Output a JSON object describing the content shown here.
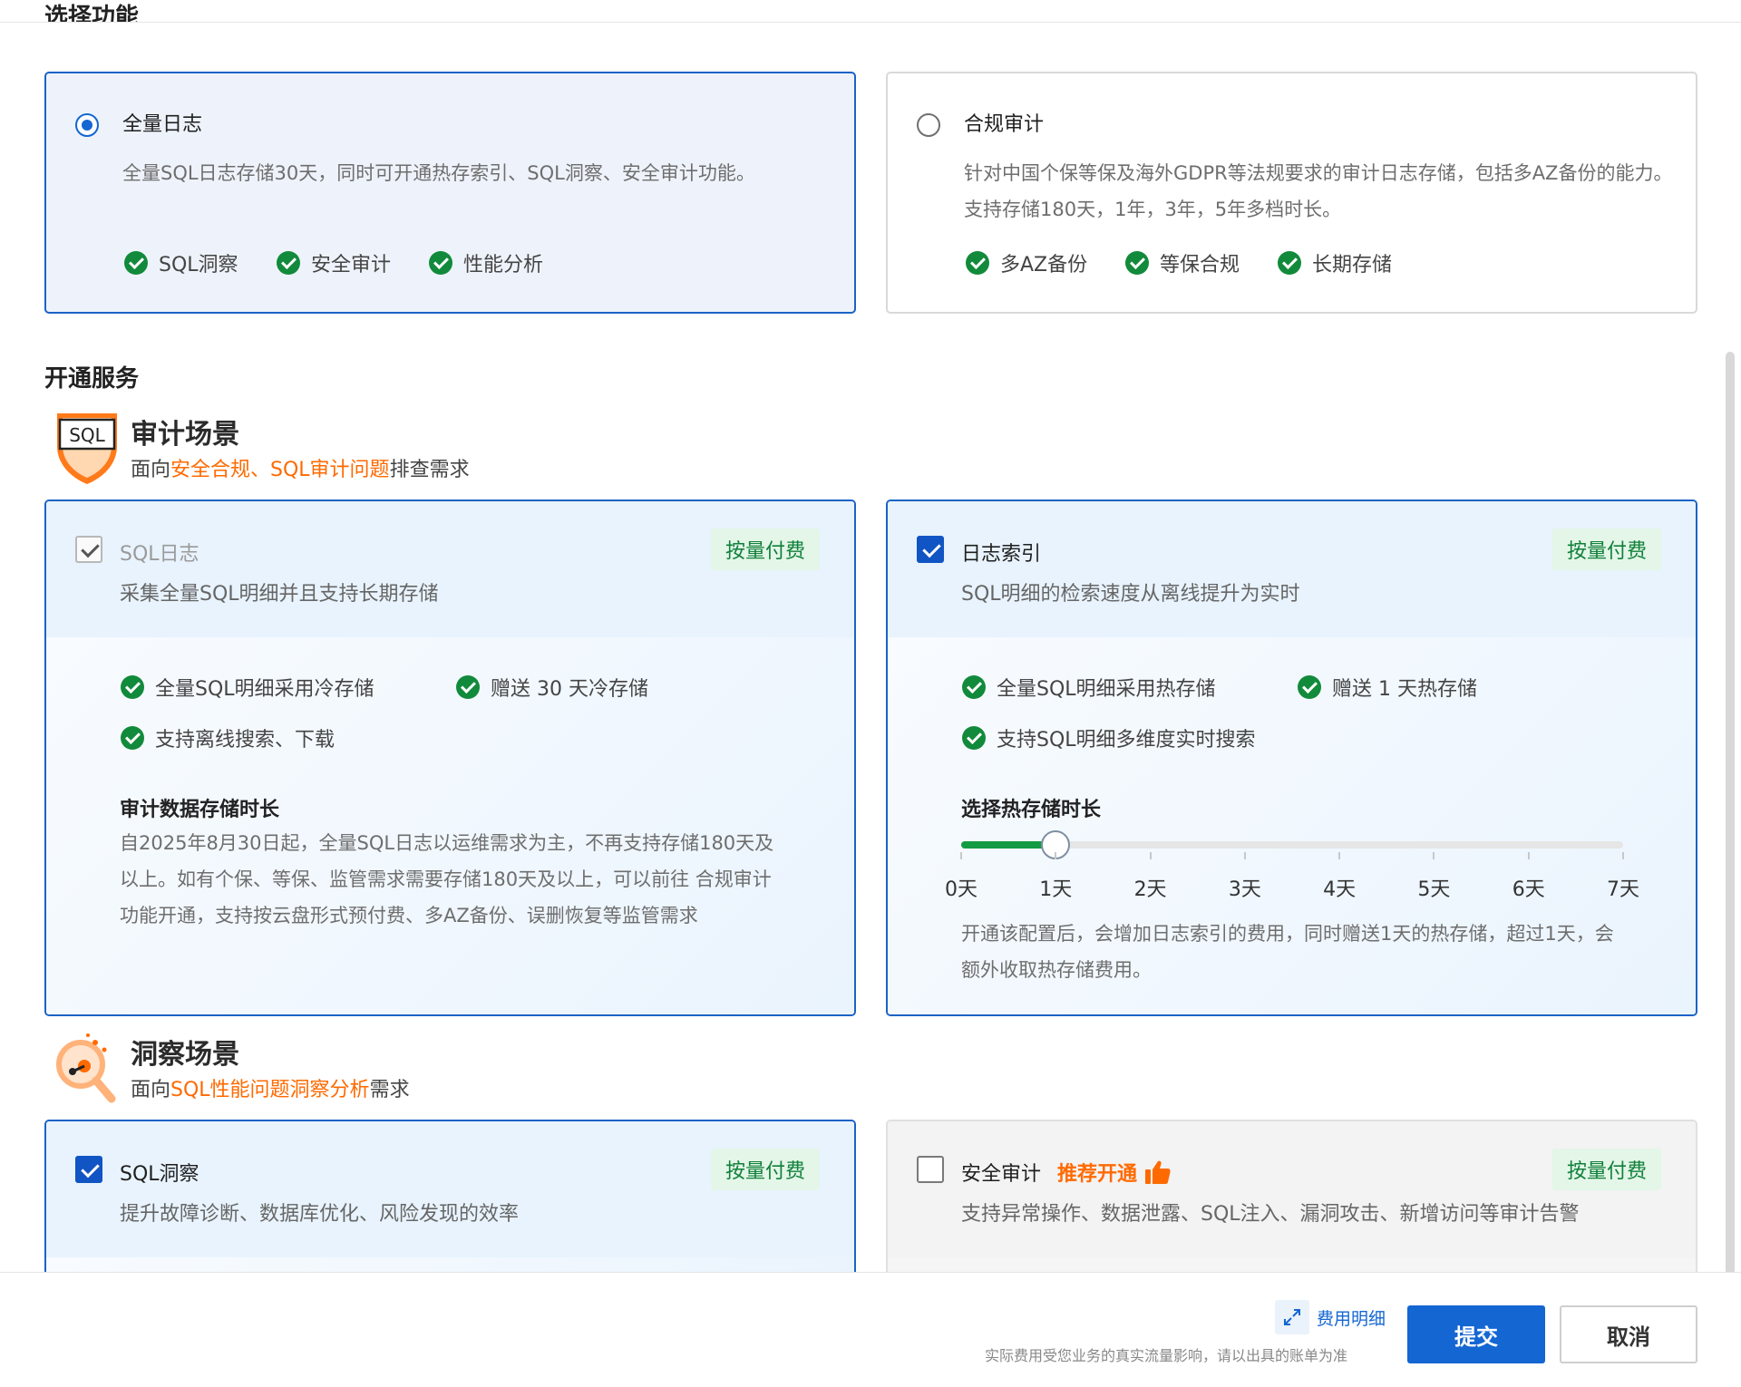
{
  "header": {
    "cut_title": "选择功能"
  },
  "options": [
    {
      "title": "全量日志",
      "desc": "全量SQL日志存储30天，同时可开通热存索引、SQL洞察、安全审计功能。",
      "checks": [
        "SQL洞察",
        "安全审计",
        "性能分析"
      ],
      "selected": true
    },
    {
      "title": "合规审计",
      "desc": "针对中国个保等保及海外GDPR等法规要求的审计日志存储，包括多AZ备份的能力。支持存储180天，1年，3年，5年多档时长。",
      "checks": [
        "多AZ备份",
        "等保合规",
        "长期存储"
      ],
      "selected": false
    }
  ],
  "services_title": "开通服务",
  "audit_scene": {
    "badge_text": "SQL",
    "title": "审计场景",
    "sub_prefix": "面向",
    "sub_highlight": "安全合规、SQL审计问题",
    "sub_suffix": "排查需求"
  },
  "insight_scene": {
    "title": "洞察场景",
    "sub_prefix": "面向",
    "sub_highlight": "SQL性能问题洞察分析",
    "sub_suffix": "需求"
  },
  "billing_badge": "按量付费",
  "sql_log": {
    "title": "SQL日志",
    "desc": "采集全量SQL明细并且支持长期存储",
    "features": [
      "全量SQL明细采用冷存储",
      "赠送 30 天冷存储",
      "支持离线搜索、下载"
    ],
    "subhead": "审计数据存储时长",
    "para": "自2025年8月30日起，全量SQL日志以运维需求为主，不再支持存储180天及以上。如有个保、等保、监管需求需要存储180天及以上，可以前往 合规审计 功能开通，支持按云盘形式预付费、多AZ备份、误删恢复等监管需求"
  },
  "log_index": {
    "title": "日志索引",
    "desc": "SQL明细的检索速度从离线提升为实时",
    "features": [
      "全量SQL明细采用热存储",
      "赠送 1 天热存储",
      "支持SQL明细多维度实时搜索"
    ],
    "subhead": "选择热存储时长",
    "slider": {
      "ticks": [
        "0天",
        "1天",
        "2天",
        "3天",
        "4天",
        "5天",
        "6天",
        "7天"
      ],
      "value_days": 1,
      "max_days": 7
    },
    "para": "开通该配置后，会增加日志索引的费用，同时赠送1天的热存储，超过1天，会额外收取热存储费用。"
  },
  "sql_insight": {
    "title": "SQL洞察",
    "desc": "提升故障诊断、数据库优化、风险发现的效率",
    "checked": true
  },
  "security_audit": {
    "title": "安全审计",
    "recommend": "推荐开通",
    "desc": "支持异常操作、数据泄露、SQL注入、漏洞攻击、新增访问等审计告警",
    "checked": false
  },
  "footer": {
    "fee_detail": "费用明细",
    "note": "实际费用受您业务的真实流量影响，请以出具的账单为准",
    "submit": "提交",
    "cancel": "取消"
  },
  "colors": {
    "primary": "#1466d2",
    "success": "#128a3b",
    "highlight": "#ff6a00",
    "badge_bg": "#e3f6e8"
  }
}
